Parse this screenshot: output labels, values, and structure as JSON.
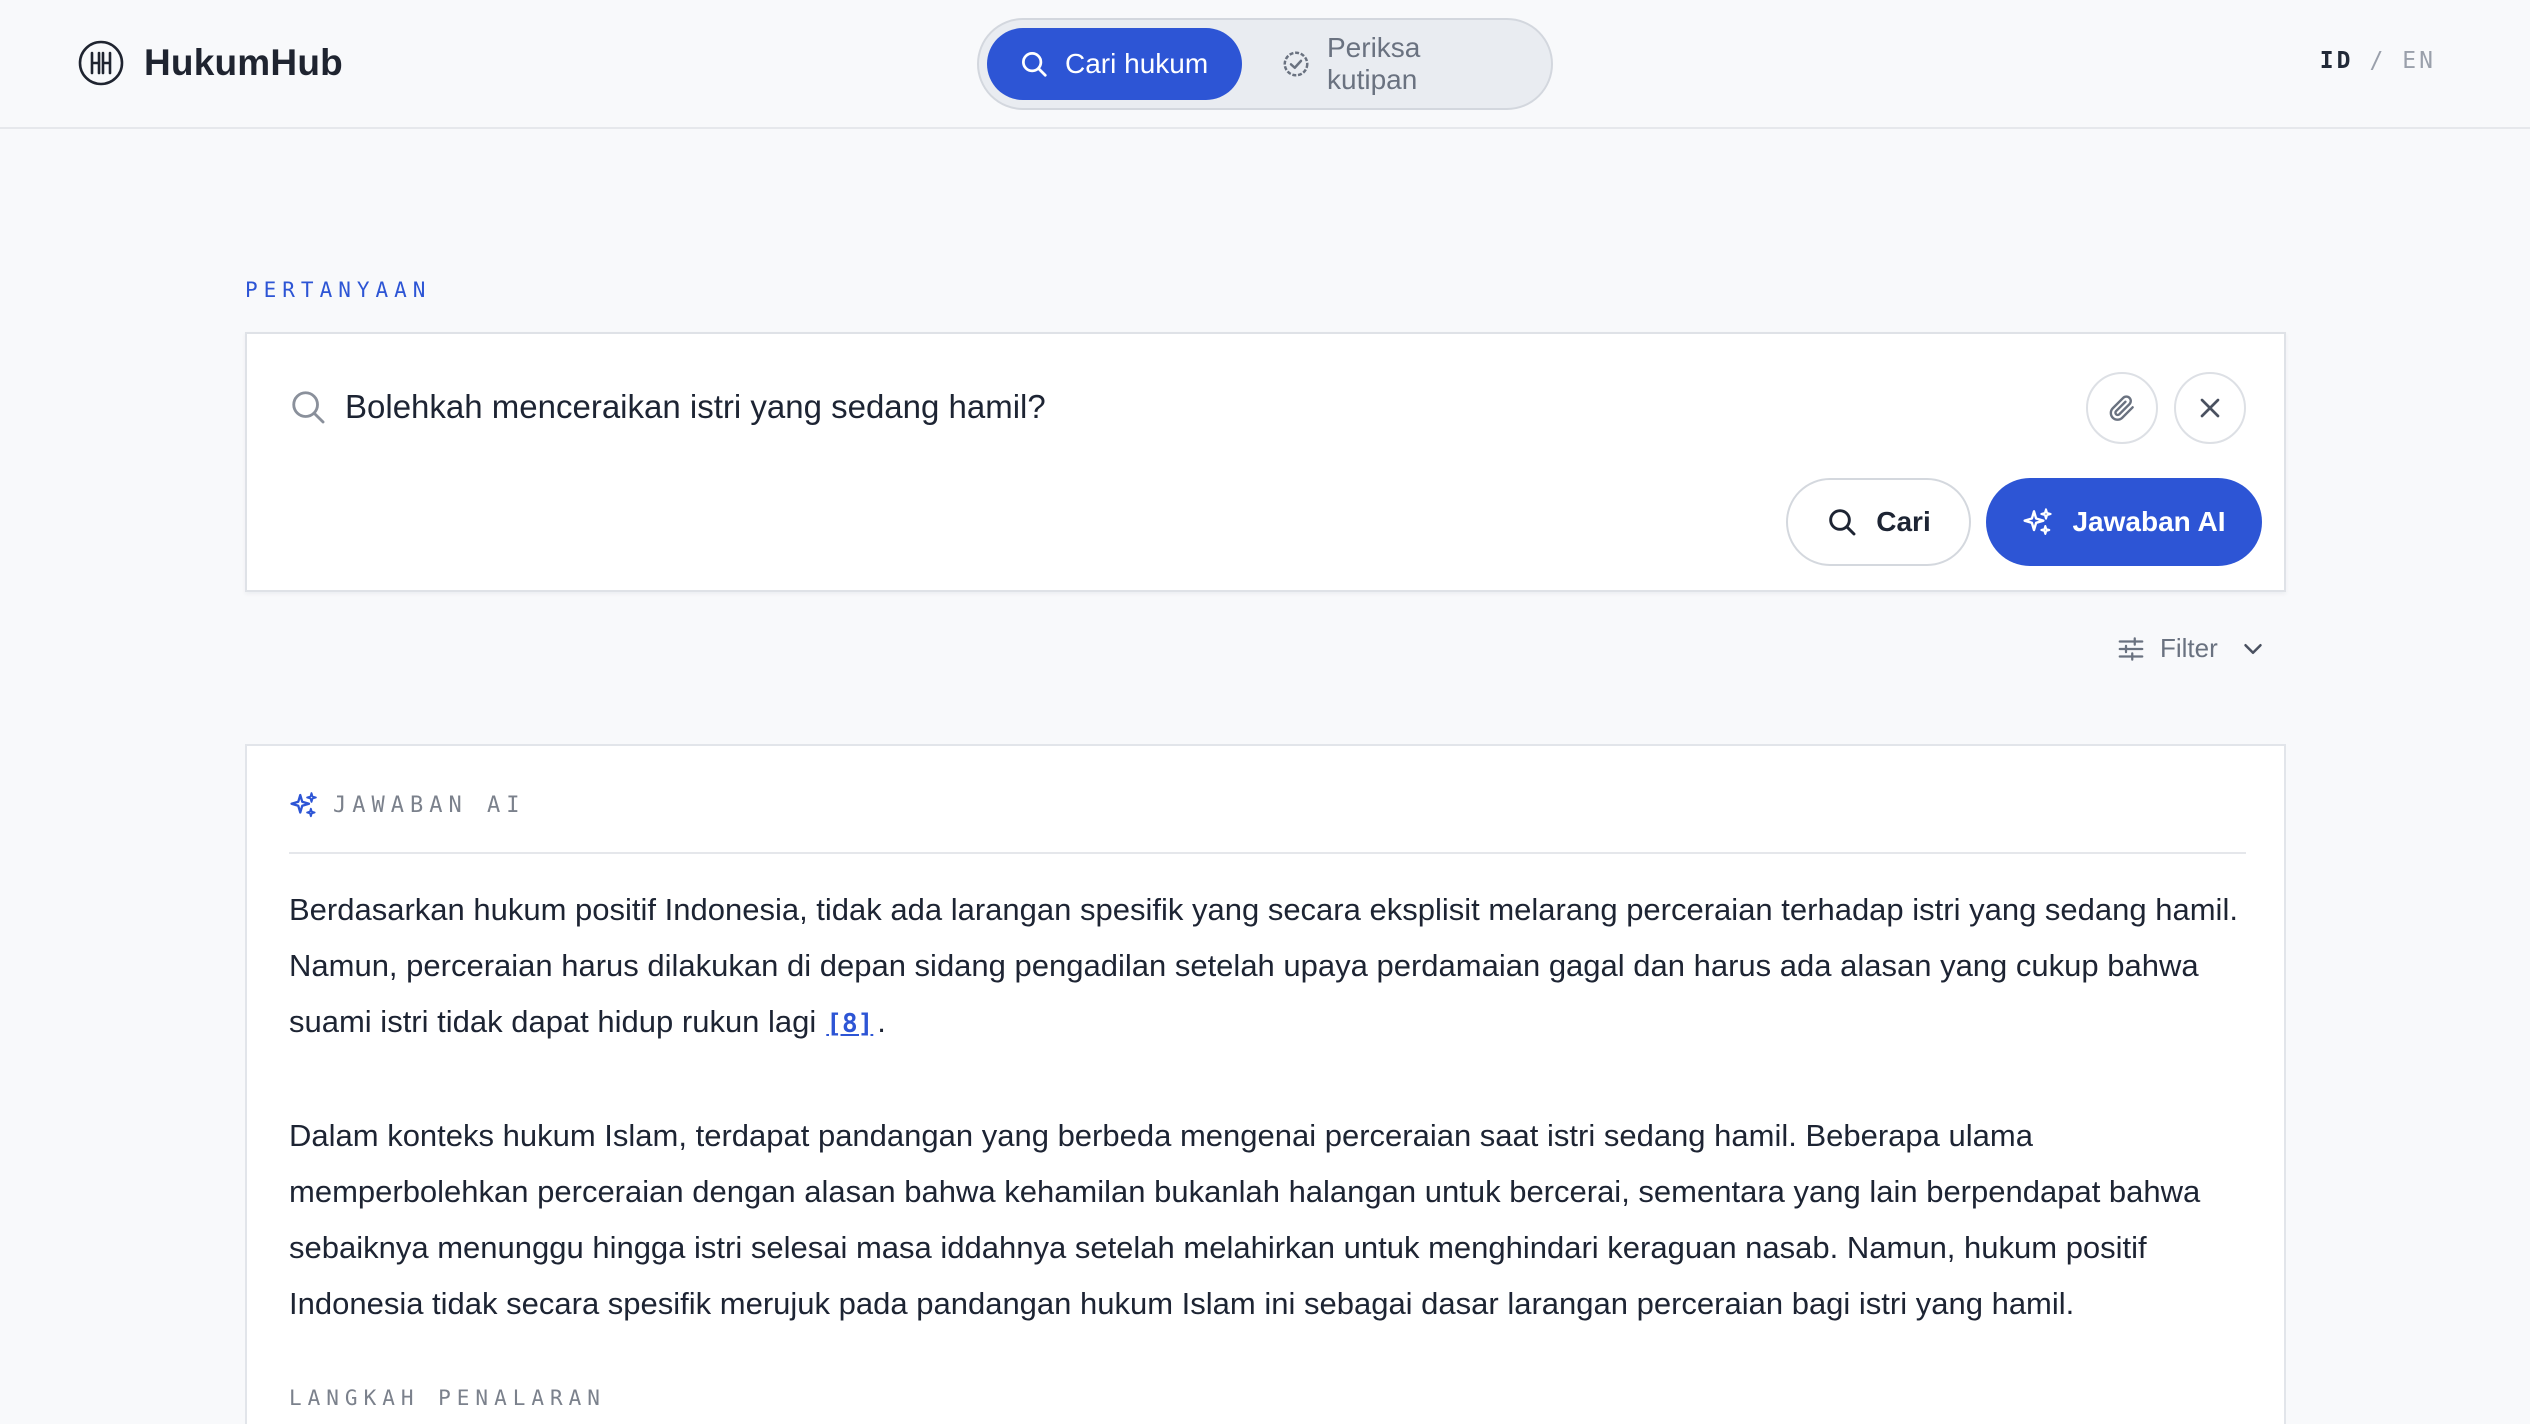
{
  "app": {
    "name": "HukumHub",
    "logo_icon": "hh-monogram-icon"
  },
  "header": {
    "modes": [
      {
        "label": "Cari hukum",
        "icon": "search-icon",
        "active": true
      },
      {
        "label": "Periksa kutipan",
        "icon": "check-circle-icon",
        "active": false
      }
    ],
    "lang": {
      "id": "ID",
      "separator": "/",
      "en": "EN",
      "active": "ID"
    }
  },
  "question": {
    "section_label": "PERTANYAAN",
    "query": "Bolehkah menceraikan istri yang sedang hamil?",
    "attach_icon": "paperclip-icon",
    "clear_icon": "close-icon",
    "search_button": "Cari",
    "ai_button": "Jawaban AI",
    "filter_label": "Filter"
  },
  "answer": {
    "section_label": "JAWABAN AI",
    "paragraph1": "Berdasarkan hukum positif Indonesia, tidak ada larangan spesifik yang secara eksplisit melarang perceraian terhadap istri yang sedang hamil. Namun, perceraian harus dilakukan di depan sidang pengadilan setelah upaya perdamaian gagal dan harus ada alasan yang cukup bahwa suami istri tidak dapat hidup rukun lagi",
    "citation": "[8]",
    "paragraph1_end": ".",
    "paragraph2": "Dalam konteks hukum Islam, terdapat pandangan yang berbeda mengenai perceraian saat istri sedang hamil. Beberapa ulama memperbolehkan perceraian dengan alasan bahwa kehamilan bukanlah halangan untuk bercerai, sementara yang lain berpendapat bahwa sebaiknya menunggu hingga istri selesai masa iddahnya setelah melahirkan untuk menghindari keraguan nasab. Namun, hukum positif Indonesia tidak secara spesifik merujuk pada pandangan hukum Islam ini sebagai dasar larangan perceraian bagi istri yang hamil.",
    "reasoning_label": "LANGKAH PENALARAN"
  },
  "colors": {
    "accent": "#2d55d5",
    "background": "#f8f9fb",
    "text": "#1d2433",
    "muted": "#7b818c"
  }
}
